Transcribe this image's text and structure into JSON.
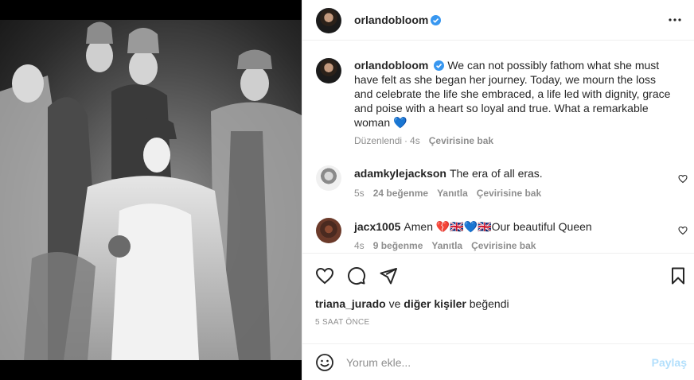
{
  "post": {
    "author": "orlandobloom",
    "image_alt": "Black-and-white coronation photograph"
  },
  "caption": {
    "author": "orlandobloom",
    "text": "We can not possibly fathom what she must have felt as she began her journey. Today, we mourn the loss and celebrate the life she embraced, a life led with dignity, grace and poise with a heart so loyal and true. What a remarkable woman 💙",
    "edited_label": "Düzenlendi",
    "time": "4s",
    "translate_label": "Çevirisine bak"
  },
  "comments": [
    {
      "author": "adamkylejackson",
      "text": "The era of all eras.",
      "time": "5s",
      "likes": "24 beğenme",
      "reply_label": "Yanıtla",
      "translate_label": "Çevirisine bak"
    },
    {
      "author": "jacx1005",
      "text": "Amen 💔🇬🇧💙🇬🇧Our beautiful Queen",
      "time": "4s",
      "likes": "9 beğenme",
      "reply_label": "Yanıtla",
      "translate_label": "Çevirisine bak"
    }
  ],
  "likes": {
    "first_user": "triana_jurado",
    "connector": "ve",
    "others": "diğer kişiler",
    "suffix": "beğendi"
  },
  "time_ago": "5 SAAT ÖNCE",
  "add_comment": {
    "placeholder": "Yorum ekle...",
    "share_label": "Paylaş"
  },
  "icons": {
    "verified": "verified-badge-icon",
    "more": "more-options-icon",
    "like": "heart-icon",
    "comment": "comment-icon",
    "share": "paper-plane-icon",
    "save": "bookmark-icon",
    "emoji": "emoji-icon"
  },
  "colors": {
    "verified_blue": "#3897f0",
    "share_disabled": "#b2dffc",
    "meta_gray": "#8e8e8e"
  }
}
